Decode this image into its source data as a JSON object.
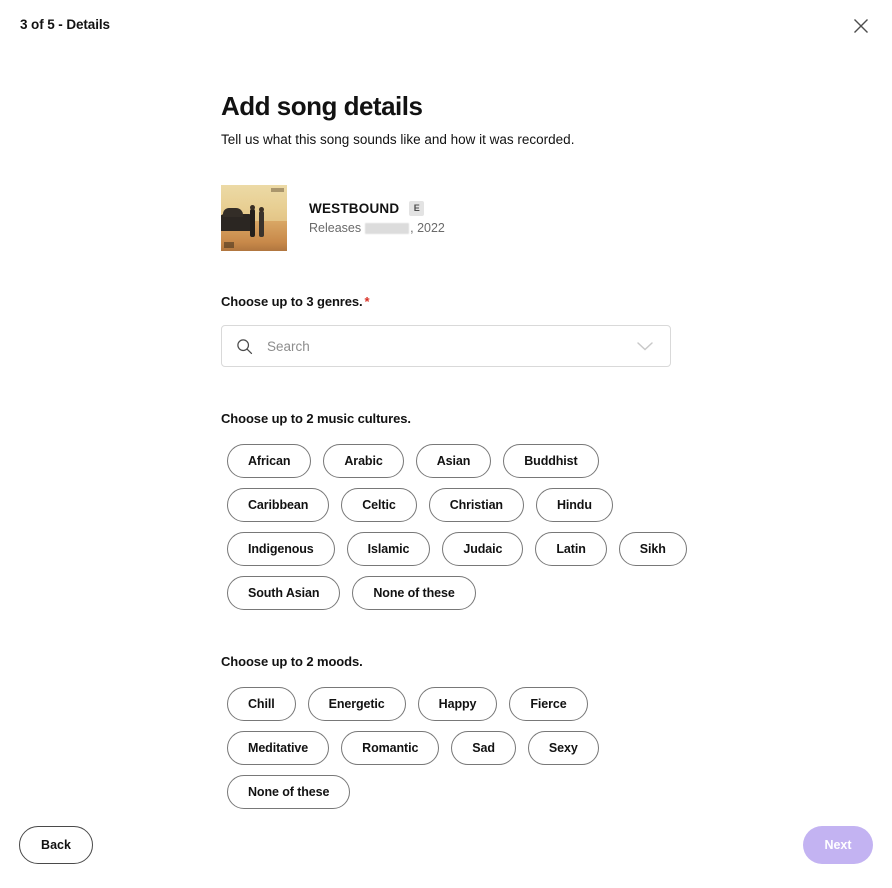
{
  "topbar": {
    "step_label": "3 of 5 - Details",
    "close_icon": "close-icon"
  },
  "header": {
    "title": "Add song details",
    "subtitle": "Tell us what this song sounds like and how it was recorded."
  },
  "song": {
    "title": "WESTBOUND",
    "explicit_badge": "E",
    "release_prefix": "Releases",
    "release_redacted": "",
    "release_suffix": ", 2022",
    "cover_alt": "album-artwork"
  },
  "genres": {
    "label": "Choose up to 3 genres.",
    "required_marker": "*",
    "search_placeholder": "Search",
    "search_value": "",
    "search_icon": "search-icon",
    "chevron_icon": "chevron-down-icon"
  },
  "cultures": {
    "label": "Choose up to 2 music cultures.",
    "rows": [
      [
        "African",
        "Arabic",
        "Asian",
        "Buddhist"
      ],
      [
        "Caribbean",
        "Celtic",
        "Christian",
        "Hindu"
      ],
      [
        "Indigenous",
        "Islamic",
        "Judaic",
        "Latin",
        "Sikh"
      ],
      [
        "South Asian",
        "None of these"
      ]
    ]
  },
  "moods": {
    "label": "Choose up to 2 moods.",
    "rows": [
      [
        "Chill",
        "Energetic",
        "Happy",
        "Fierce"
      ],
      [
        "Meditative",
        "Romantic",
        "Sad",
        "Sexy"
      ],
      [
        "None of these"
      ]
    ]
  },
  "footer": {
    "back_label": "Back",
    "next_label": "Next"
  },
  "colors": {
    "text": "#121212",
    "muted": "#6a6a6a",
    "required": "#d93025",
    "next_button": "#c3b3f2",
    "chip_border": "#787878",
    "input_border": "#d9d9d9"
  }
}
